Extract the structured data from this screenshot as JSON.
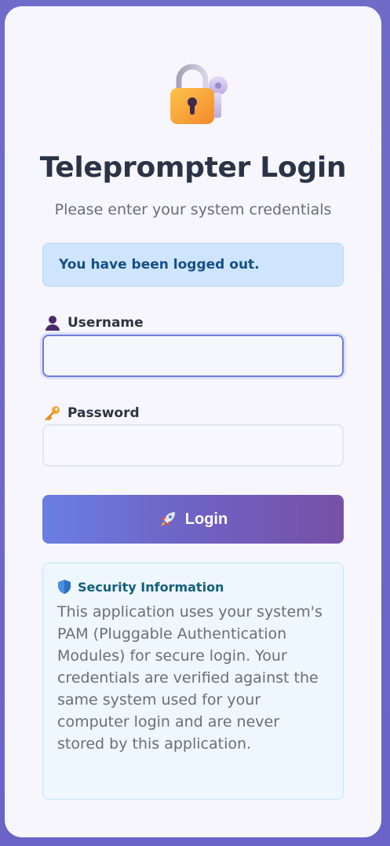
{
  "login": {
    "title": "Teleprompter Login",
    "subtitle": "Please enter your system credentials",
    "alert": "You have been logged out.",
    "username": {
      "label": "Username",
      "value": "",
      "icon": "user-icon"
    },
    "password": {
      "label": "Password",
      "value": "",
      "icon": "key-icon"
    },
    "submit": {
      "label": "Login",
      "icon": "rocket-icon"
    },
    "security": {
      "heading": "Security Information",
      "icon": "shield-icon",
      "text": "This application uses your system's PAM (Pluggable Authentication Modules) for secure login. Your credentials are verified against the same system used for your computer login and are never stored by this application."
    }
  },
  "colors": {
    "background": "#6f6cc9",
    "card": "#f7f6fc",
    "alert_bg": "#cfe5fd",
    "alert_text": "#154f84",
    "button_start": "#6a7ee3",
    "button_end": "#7750a6",
    "info_bg": "#eef6fe",
    "info_heading": "#14607a"
  }
}
